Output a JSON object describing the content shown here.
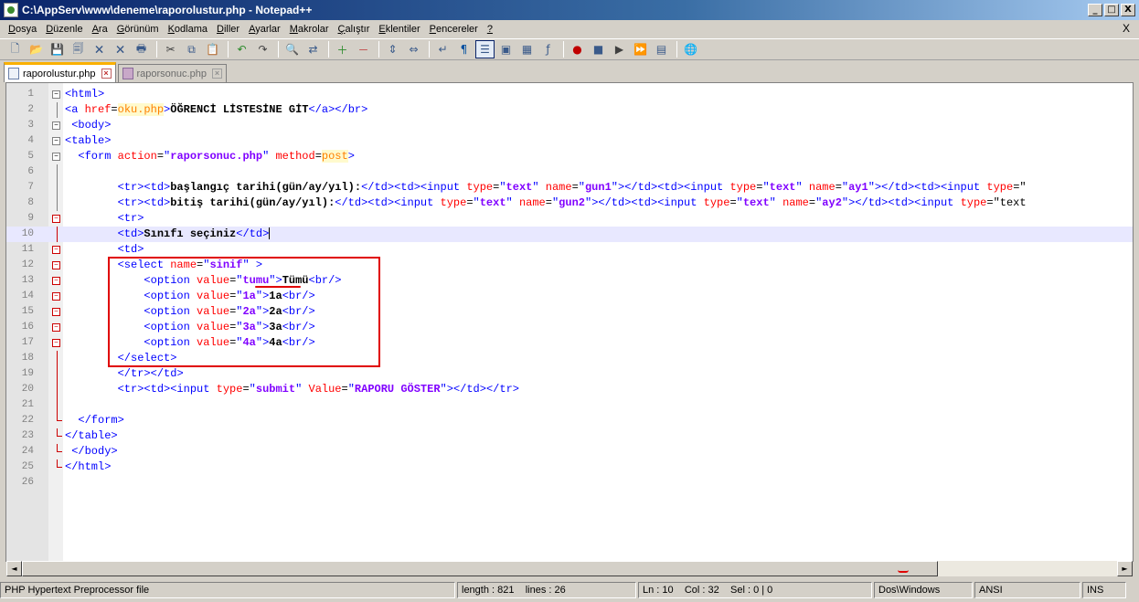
{
  "window": {
    "title": "C:\\AppServ\\www\\deneme\\raporolustur.php - Notepad++"
  },
  "window_buttons": {
    "minimize": "_",
    "maximize": "□",
    "close": "X"
  },
  "menu": {
    "items": [
      {
        "label": "Dosya",
        "u": "D",
        "rest": "osya"
      },
      {
        "label": "Düzenle",
        "u": "D",
        "rest": "üzenle"
      },
      {
        "label": "Ara",
        "u": "A",
        "rest": "ra"
      },
      {
        "label": "Görünüm",
        "u": "G",
        "rest": "örünüm"
      },
      {
        "label": "Kodlama",
        "u": "K",
        "rest": "odlama"
      },
      {
        "label": "Diller",
        "u": "D",
        "rest": "iller"
      },
      {
        "label": "Ayarlar",
        "u": "A",
        "rest": "yarlar"
      },
      {
        "label": "Makrolar",
        "u": "M",
        "rest": "akrolar"
      },
      {
        "label": "Çalıştır",
        "u": "Ç",
        "rest": "alıştır"
      },
      {
        "label": "Eklentiler",
        "u": "E",
        "rest": "klentiler"
      },
      {
        "label": "Pencereler",
        "u": "P",
        "rest": "encereler"
      },
      {
        "label": "?",
        "u": "?",
        "rest": ""
      }
    ],
    "doc_close": "X"
  },
  "toolbar_icons": [
    "new-file-icon",
    "open-file-icon",
    "save-icon",
    "save-all-icon",
    "close-icon",
    "close-all-icon",
    "print-icon",
    "cut-icon",
    "copy-icon",
    "paste-icon",
    "undo-icon",
    "redo-icon",
    "find-icon",
    "replace-icon",
    "zoom-in-icon",
    "zoom-out-icon",
    "sync-vertical-icon",
    "sync-horizontal-icon",
    "word-wrap-icon",
    "show-all-chars-icon",
    "indent-guide-icon",
    "user-defined-lang-icon",
    "doc-map-icon",
    "function-list-icon",
    "record-macro-icon",
    "stop-macro-icon",
    "play-macro-icon",
    "run-macro-multiple-icon",
    "save-macro-icon",
    "launch-browser-icon"
  ],
  "tabs": [
    {
      "label": "raporolustur.php",
      "active": true
    },
    {
      "label": "raporsonuc.php",
      "active": false
    }
  ],
  "editor": {
    "current_line": 10,
    "lines": [
      "<html>",
      "<a href=oku.php>ÖĞRENCİ LİSTESİNE GİT</a></br>",
      " <body>",
      "<table>",
      "  <form action=\"raporsonuc.php\" method=post>",
      "",
      "        <tr><td>başlangıç tarihi(gün/ay/yıl):</td><td><input type=\"text\" name=\"gun1\"></td><td><input type=\"text\" name=\"ay1\"></td><td><input type=\"",
      "        <tr><td>bitiş tarihi(gün/ay/yıl):</td><td><input type=\"text\" name=\"gun2\"></td><td><input type=\"text\" name=\"ay2\"></td><td><input type=\"text",
      "        <tr>",
      "        <td>Sınıfı seçiniz</td>",
      "        <td>",
      "        <select name=\"sinif\" >",
      "            <option value=\"tumu\">Tümü<br/>",
      "            <option value=\"1a\">1a<br/>",
      "            <option value=\"2a\">2a<br/>",
      "            <option value=\"3a\">3a<br/>",
      "            <option value=\"4a\">4a<br/>",
      "        </select>",
      "        </tr></td>",
      "        <tr><td><input type=\"submit\" Value=\"RAPORU GÖSTER\"></td></tr>",
      "",
      "  </form>",
      "</table>",
      " </body>",
      "</html>",
      ""
    ]
  },
  "scrollbar": {
    "left": "◄",
    "right": "►"
  },
  "status": {
    "filetype": "PHP Hypertext Preprocessor file",
    "length": "length : 821",
    "lines": "lines : 26",
    "position": "Ln : 10    Col : 32    Sel : 0 | 0",
    "eol": "Dos\\Windows",
    "encoding": "ANSI",
    "mode": "INS"
  }
}
